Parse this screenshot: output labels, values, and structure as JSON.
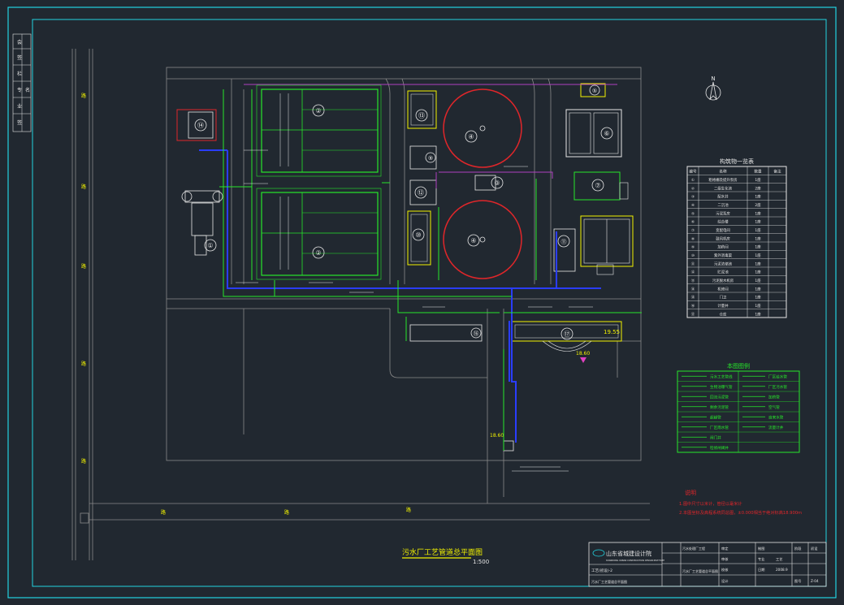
{
  "drawing": {
    "title": "污水厂工艺管道总平面图",
    "scale": "1:500",
    "north_symbol": "N",
    "elevations": {
      "building_17": "19.55",
      "site_arrow": "18.60",
      "outfall": "18.60"
    }
  },
  "units": [
    {
      "id": "unit-1",
      "number": "①"
    },
    {
      "id": "unit-2a",
      "number": "②"
    },
    {
      "id": "unit-2b",
      "number": "②"
    },
    {
      "id": "unit-3",
      "number": "③"
    },
    {
      "id": "unit-4a",
      "number": "④"
    },
    {
      "id": "unit-4b",
      "number": "④"
    },
    {
      "id": "unit-5",
      "number": "⑤"
    },
    {
      "id": "unit-6",
      "number": "⑥"
    },
    {
      "id": "unit-7",
      "number": "⑦"
    },
    {
      "id": "unit-9",
      "number": "⑨"
    },
    {
      "id": "unit-10",
      "number": "⑩"
    },
    {
      "id": "unit-11",
      "number": "⑪"
    },
    {
      "id": "unit-12",
      "number": "⑫"
    },
    {
      "id": "unit-13",
      "number": "⑬"
    },
    {
      "id": "unit-14",
      "number": "⑭"
    },
    {
      "id": "unit-16",
      "number": "⑯"
    },
    {
      "id": "unit-17",
      "number": "⑰"
    }
  ],
  "structure_table": {
    "title": "构筑物一览表",
    "headers": [
      "编号",
      "名称",
      "数量",
      "备注"
    ],
    "rows": [
      [
        "①",
        "粗格栅及提升泵房",
        "1座",
        ""
      ],
      [
        "②",
        "二级生化池",
        "2座",
        ""
      ],
      [
        "③",
        "配水井",
        "1座",
        ""
      ],
      [
        "④",
        "二沉池",
        "2座",
        ""
      ],
      [
        "⑤",
        "污泥泵房",
        "1座",
        ""
      ],
      [
        "⑥",
        "综合楼",
        "1座",
        ""
      ],
      [
        "⑦",
        "变配电间",
        "1座",
        ""
      ],
      [
        "⑧",
        "鼓风机房",
        "1座",
        ""
      ],
      [
        "⑨",
        "加药间",
        "1座",
        ""
      ],
      [
        "⑩",
        "紫外消毒渠",
        "1座",
        ""
      ],
      [
        "⑪",
        "污泥浓缩池",
        "1座",
        ""
      ],
      [
        "⑫",
        "贮泥池",
        "1座",
        ""
      ],
      [
        "⑬",
        "污泥脱水机房",
        "1座",
        ""
      ],
      [
        "⑭",
        "机修间",
        "1座",
        ""
      ],
      [
        "⑮",
        "门卫",
        "1座",
        ""
      ],
      [
        "⑯",
        "计量井",
        "1座",
        ""
      ],
      [
        "⑰",
        "仓库",
        "1座",
        ""
      ]
    ]
  },
  "legend": {
    "title": "本图图例",
    "left": [
      "污水工艺管线",
      "生物池曝气管",
      "回流污泥管",
      "剩余污泥管",
      "超越管",
      "厂区雨水管",
      "闸门井",
      "检修闸阀井"
    ],
    "right": [
      "厂区给水管",
      "厂区污水管",
      "加药管",
      "空气管",
      "自来水管",
      "流量计井"
    ]
  },
  "notes": {
    "title": "说明",
    "items": [
      "1.图中尺寸以米计，管径以毫米计",
      "2.本图坐标及高程系统同总图，±0.000相当于绝对标高18.900m"
    ]
  },
  "title_block": {
    "company": "山东省城建设计院",
    "company_en": "SHANDONG URBAN CONSTRUCTION DESIGN INSTITUTE",
    "project": "污水处理厂工程",
    "drawing_name": "污水厂工艺管道总平面图",
    "drawing_no": "工艺(初设)-2",
    "cells": [
      "审定",
      "审核",
      "校核",
      "设计",
      "制图",
      "专业",
      "工艺",
      "日期",
      "2008.9",
      "阶段",
      "初设",
      "图号",
      "Z-04"
    ]
  },
  "side_strip": [
    "会",
    "签",
    "栏",
    "专",
    "业",
    "签",
    "名"
  ],
  "road_label": "路",
  "colors": {
    "background": "#212830",
    "frame": "#22d3e0",
    "green": "#26e62a",
    "blue": "#2a3dff",
    "magenta": "#b040c0",
    "red": "#e0262a",
    "yellow": "#f2f200",
    "white": "#e6e6e6",
    "gray": "#8a8a8a"
  }
}
